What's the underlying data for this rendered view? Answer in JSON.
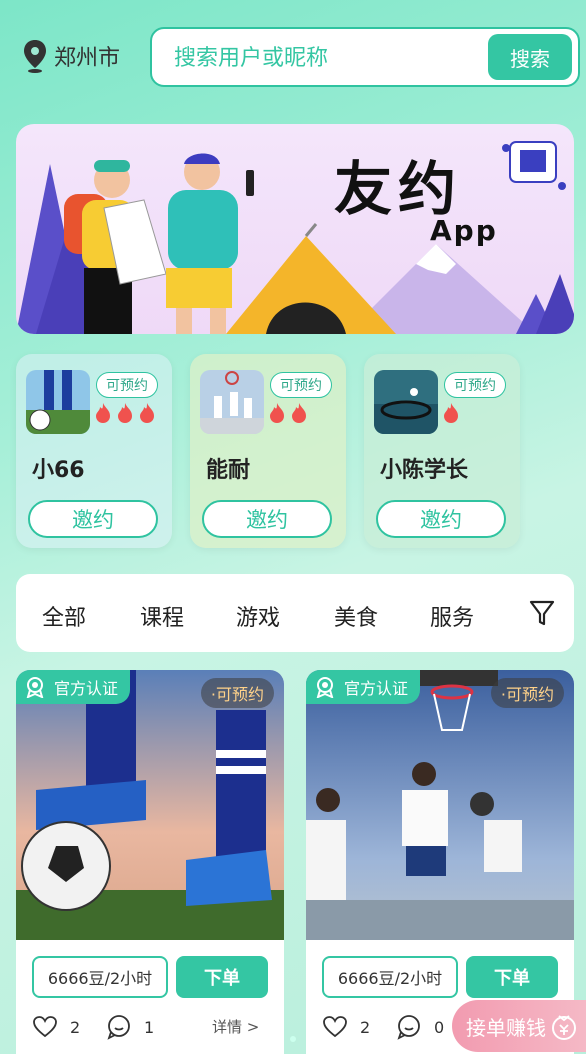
{
  "header": {
    "city": "郑州市",
    "search_placeholder": "搜索用户或昵称",
    "search_button": "搜索"
  },
  "banner": {
    "title": "友约",
    "subtitle": "App"
  },
  "users": [
    {
      "name": "小66",
      "badge": "可预约",
      "flames": 3,
      "invite": "邀约"
    },
    {
      "name": "能耐",
      "badge": "可预约",
      "flames": 2,
      "invite": "邀约"
    },
    {
      "name": "小陈学长",
      "badge": "可预约",
      "flames": 1,
      "invite": "邀约"
    }
  ],
  "tabs": [
    "全部",
    "课程",
    "游戏",
    "美食",
    "服务"
  ],
  "products": [
    {
      "cert": "官方认证",
      "status": "·可预约",
      "price": "6666豆/2小时",
      "order": "下单",
      "likes": "2",
      "comments": "1",
      "detail": "详情 >"
    },
    {
      "cert": "官方认证",
      "status": "·可预约",
      "price": "6666豆/2小时",
      "order": "下单",
      "likes": "2",
      "comments": "0"
    }
  ],
  "float_button": {
    "label": "接单赚钱"
  },
  "colors": {
    "accent": "#34c6a3",
    "flame": "#f0524e",
    "earn": "#f29bb0"
  }
}
